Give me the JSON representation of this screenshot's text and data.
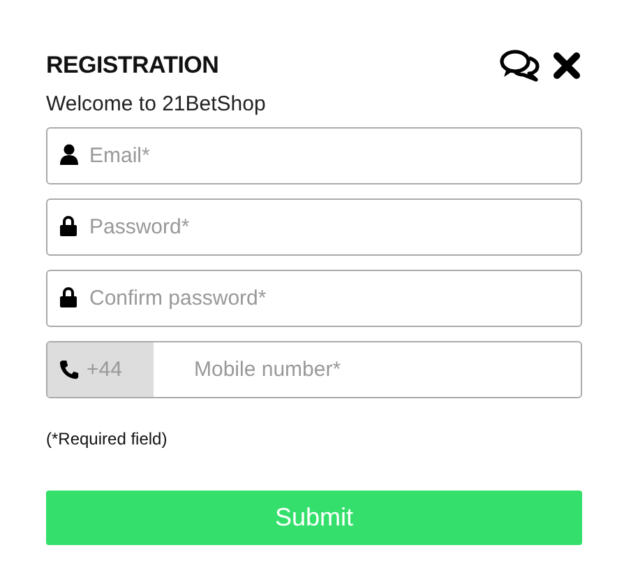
{
  "dialog": {
    "title": "REGISTRATION",
    "welcome": "Welcome to 21BetShop"
  },
  "fields": [
    {
      "kind": "email",
      "placeholder": "Email*"
    },
    {
      "kind": "password",
      "placeholder": "Password*"
    },
    {
      "kind": "password",
      "placeholder": "Confirm password*"
    },
    {
      "kind": "phone",
      "prefix": "+44",
      "placeholder": "Mobile number*"
    }
  ],
  "note": "(*Required field)",
  "submit": "Submit"
}
